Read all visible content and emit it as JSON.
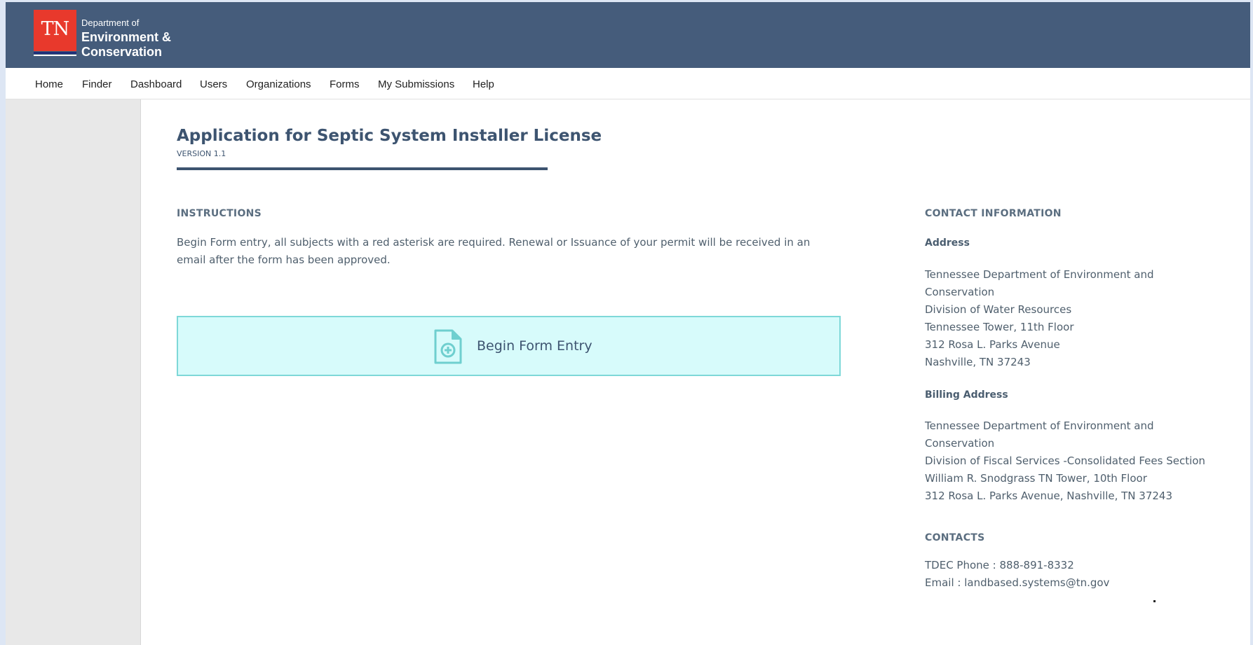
{
  "header": {
    "logo_mark": "TN",
    "logo_line1": "Department of",
    "logo_line2": "Environment &",
    "logo_line3": "Conservation",
    "color": "#455c7b",
    "accent": "#e8392c"
  },
  "nav": {
    "items": [
      "Home",
      "Finder",
      "Dashboard",
      "Users",
      "Organizations",
      "Forms",
      "My Submissions",
      "Help"
    ]
  },
  "form": {
    "title": "Application for Septic System Installer License",
    "version": "VERSION 1.1"
  },
  "instructions": {
    "heading": "INSTRUCTIONS",
    "text": "Begin Form entry, all subjects with a red asterisk are required. Renewal or Issuance of your permit will be received in an email after the form has been approved.",
    "begin_button": "Begin Form Entry",
    "begin_icon": "file-plus-icon",
    "button_color": "#d7fbfb"
  },
  "contact": {
    "heading": "CONTACT INFORMATION",
    "address_label": "Address",
    "address_lines": [
      "Tennessee Department of Environment and",
      "Conservation",
      "Division of Water Resources",
      "Tennessee Tower, 11th Floor",
      "312 Rosa L. Parks Avenue",
      "Nashville, TN 37243"
    ],
    "billing_label": "Billing Address",
    "billing_lines": [
      "Tennessee Department of Environment and",
      "Conservation",
      "Division of Fiscal Services -Consolidated Fees Section",
      "William R. Snodgrass TN Tower, 10th Floor",
      "312 Rosa L. Parks Avenue, Nashville, TN 37243"
    ],
    "contacts_heading": "CONTACTS",
    "phone_line": "TDEC Phone : 888-891-8332",
    "email_prefix": "Email : ",
    "email": "landbased.systems@tn.gov"
  }
}
